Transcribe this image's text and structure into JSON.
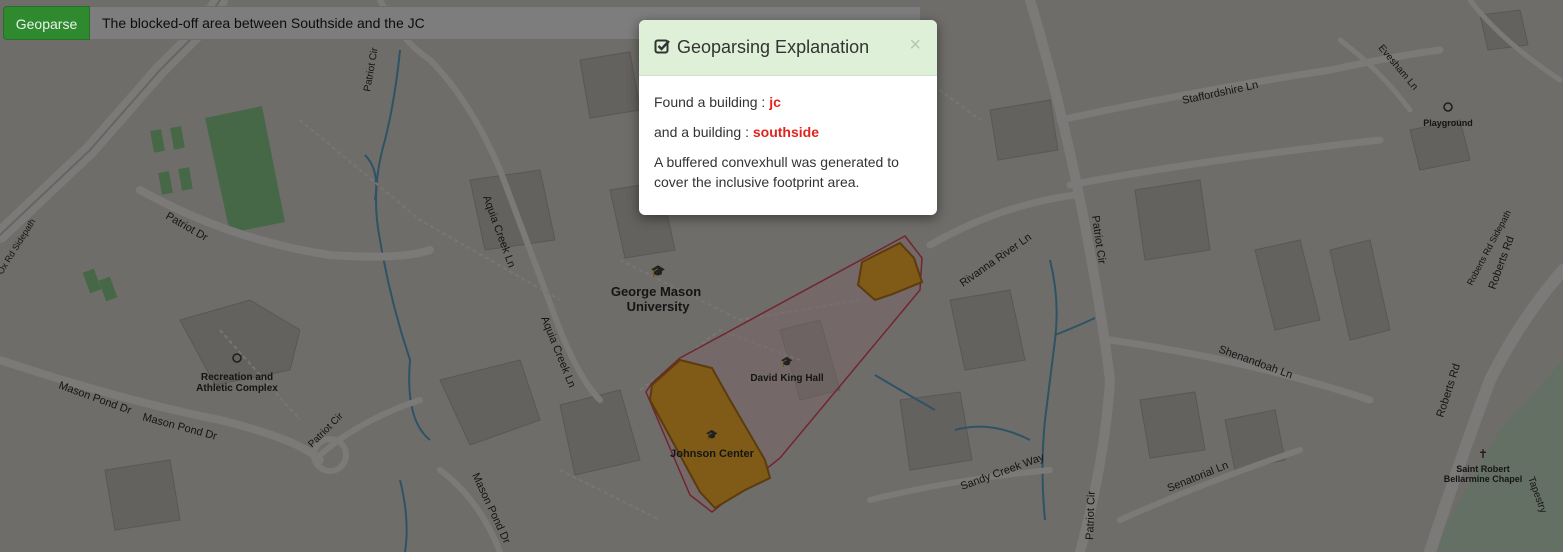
{
  "search": {
    "button_label": "Geoparse",
    "query": "The blocked-off area between Southside and the JC"
  },
  "modal": {
    "title": "Geoparsing Explanation",
    "close": "×",
    "line1_prefix": "Found a building : ",
    "line1_value": "jc",
    "line2_prefix": "and a building : ",
    "line2_value": "southside",
    "line3": "A buffered convexhull was generated to cover the inclusive footprint area."
  },
  "map": {
    "labels": {
      "gmu_line1": "George Mason",
      "gmu_line2": "University",
      "david_king": "David King Hall",
      "johnson": "Johnson Center",
      "rac_line1": "Recreation and",
      "rac_line2": "Athletic Complex",
      "playground": "Playground",
      "chapel_line1": "Saint Robert",
      "chapel_line2": "Bellarmine Chapel",
      "patriot_cir_top": "Patriot Cir",
      "patriot_dr": "Patriot Dr",
      "aquia1": "Aquia Creek Ln",
      "aquia2": "Aquia Creek Ln",
      "mason_pond1": "Mason Pond Dr",
      "mason_pond2": "Mason Pond Dr",
      "mason_pond3": "Mason Pond Dr",
      "patriot_cir_bl": "Patriot Cir",
      "patriot_cir_right": "Patriot Cir",
      "patriot_cir_bottom": "Patriot Cir",
      "rivanna": "Rivanna River Ln",
      "staffordshire": "Staffordshire Ln",
      "evesham": "Evesham Ln",
      "shenandoah": "Shenandoah Ln",
      "sandy_creek": "Sandy Creek Way",
      "senatorial": "Senatorial Ln",
      "roberts_rd1": "Roberts Rd",
      "roberts_rd2": "Roberts Rd",
      "roberts_sidepath": "Roberts Rd Sidepath",
      "ox_sidepath": "Ox Rd Sidepath",
      "tapestry": "Tapestry"
    },
    "colors": {
      "building_fill": "#ffb72e",
      "hull_stroke": "#e34a5f",
      "water": "#5aa6c8",
      "park": "#8fd08f",
      "button_green": "#2f8a2f",
      "highlight_red": "#e0241f"
    }
  }
}
